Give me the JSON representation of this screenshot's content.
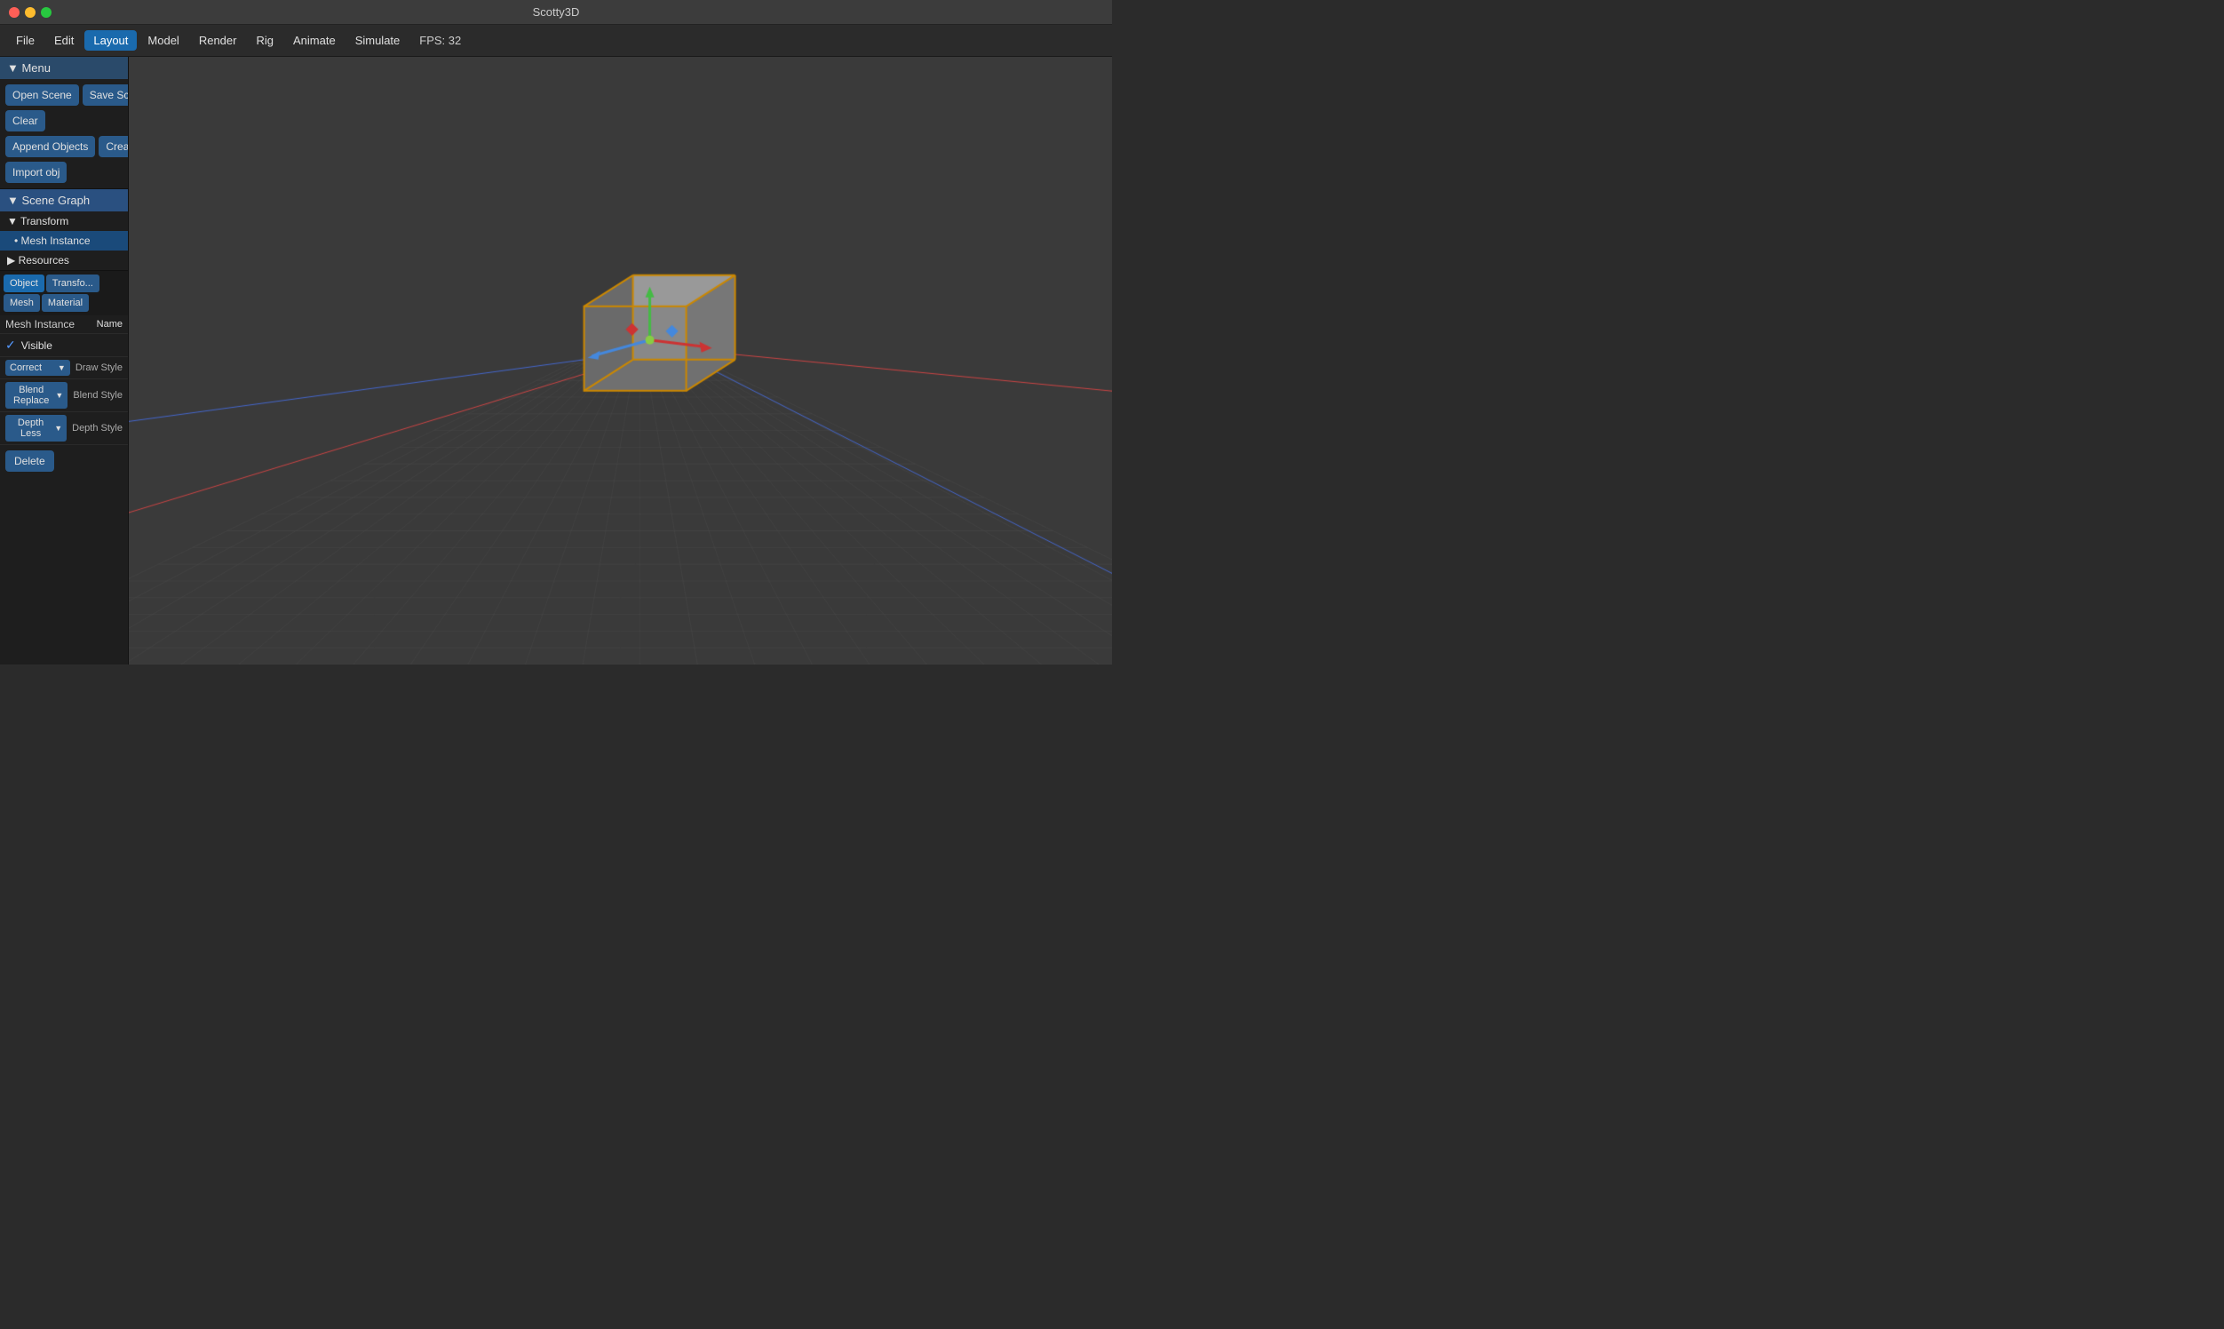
{
  "titlebar": {
    "title": "Scotty3D"
  },
  "menubar": {
    "items": [
      {
        "label": "File",
        "active": false
      },
      {
        "label": "Edit",
        "active": false
      },
      {
        "label": "Layout",
        "active": true
      },
      {
        "label": "Model",
        "active": false
      },
      {
        "label": "Render",
        "active": false
      },
      {
        "label": "Rig",
        "active": false
      },
      {
        "label": "Animate",
        "active": false
      },
      {
        "label": "Simulate",
        "active": false
      }
    ],
    "fps": "FPS: 32"
  },
  "sidebar": {
    "menu_header": "▼ Menu",
    "open_scene": "Open Scene",
    "save_scene": "Save Scene As",
    "clear": "Clear",
    "append_objects": "Append Objects",
    "create_object": "Create Object",
    "import_obj": "Import obj",
    "scene_graph_header": "▼ Scene Graph",
    "transform_label": "▼ Transform",
    "mesh_instance_label": "• Mesh Instance",
    "resources_label": "▶ Resources"
  },
  "properties": {
    "tabs": [
      {
        "label": "Object",
        "active": true
      },
      {
        "label": "Transfo...",
        "active": false
      },
      {
        "label": "Mesh",
        "active": false
      },
      {
        "label": "Material",
        "active": false
      }
    ],
    "name_label": "Mesh Instance",
    "name_value": "Name",
    "visible_label": "Visible",
    "visible_checked": true,
    "draw_style_label": "Draw Style",
    "draw_style_value": "Correct",
    "blend_style_label": "Blend Style",
    "blend_style_value": "Blend Replace",
    "depth_style_label": "Depth Style",
    "depth_style_value": "Depth Less",
    "delete_label": "Delete"
  },
  "colors": {
    "active_tab": "#1a6aad",
    "sidebar_bg": "#1e1e1e",
    "header_bg": "#2a5080",
    "btn_bg": "#2a5a8a",
    "viewport_bg": "#3a3a3a",
    "grid_line": "#555555",
    "grid_accent_red": "#cc4444",
    "grid_accent_blue": "#4466cc",
    "cube_fill": "#888888",
    "cube_outline": "#cc8800",
    "axis_red": "#cc3333",
    "axis_green": "#44bb44",
    "axis_blue": "#4488dd"
  }
}
